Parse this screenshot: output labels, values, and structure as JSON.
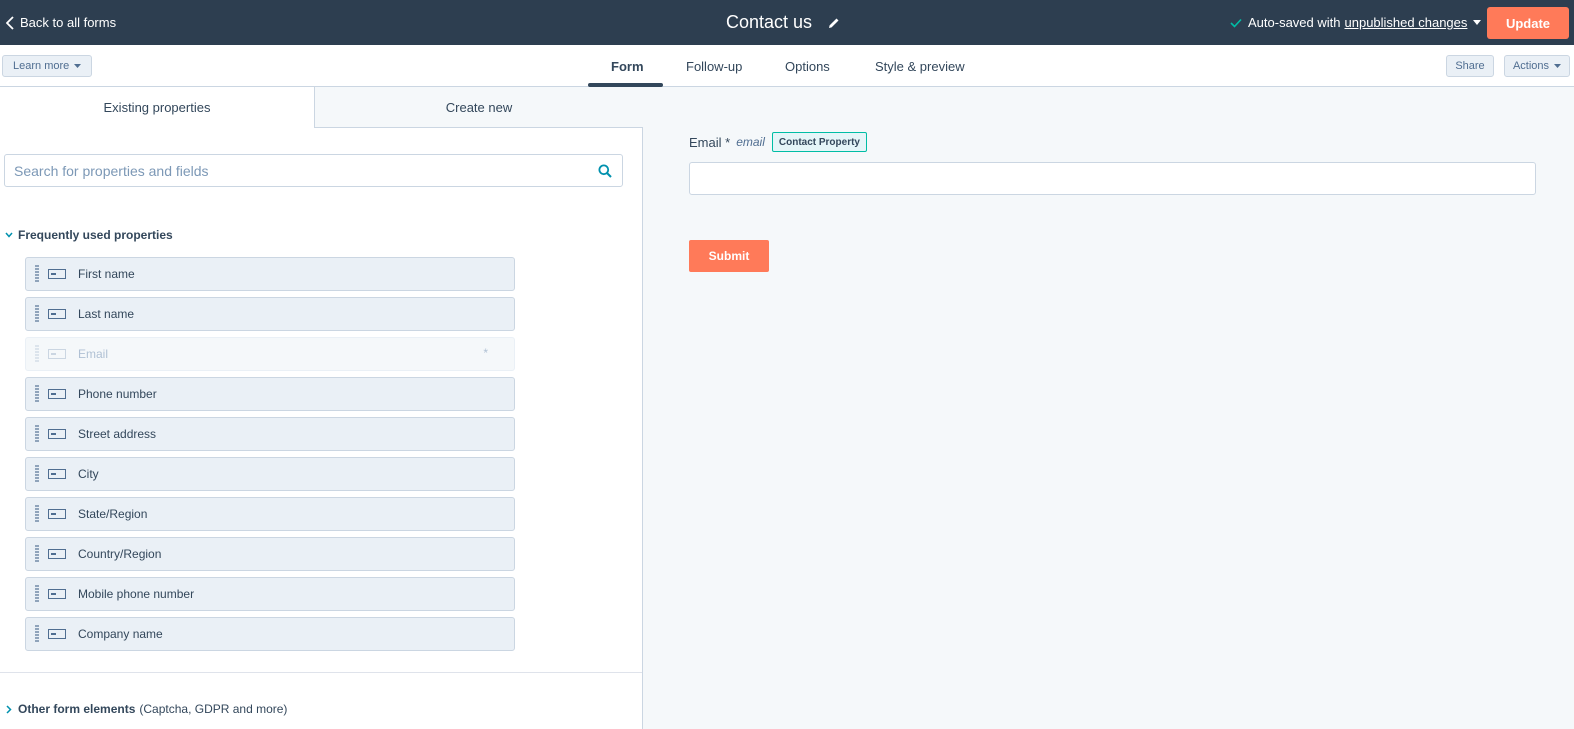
{
  "topbar": {
    "back_label": "Back to all forms",
    "form_title": "Contact us",
    "autosave_text": "Auto-saved with",
    "autosave_link": "unpublished changes",
    "update_label": "Update"
  },
  "subnav": {
    "learn_more_label": "Learn more",
    "tabs": [
      {
        "label": "Form",
        "active": true
      },
      {
        "label": "Follow-up",
        "active": false
      },
      {
        "label": "Options",
        "active": false
      },
      {
        "label": "Style & preview",
        "active": false
      }
    ],
    "share_label": "Share",
    "actions_label": "Actions"
  },
  "left_panel": {
    "tabs": [
      "Existing properties",
      "Create new"
    ],
    "search_placeholder": "Search for properties and fields",
    "section_title": "Frequently used properties",
    "properties": [
      {
        "label": "First name",
        "disabled": false
      },
      {
        "label": "Last name",
        "disabled": false
      },
      {
        "label": "Email",
        "disabled": true,
        "required_mark": "*"
      },
      {
        "label": "Phone number",
        "disabled": false
      },
      {
        "label": "Street address",
        "disabled": false
      },
      {
        "label": "City",
        "disabled": false
      },
      {
        "label": "State/Region",
        "disabled": false
      },
      {
        "label": "Country/Region",
        "disabled": false
      },
      {
        "label": "Mobile phone number",
        "disabled": false
      },
      {
        "label": "Company name",
        "disabled": false
      }
    ],
    "other_title": "Other form elements",
    "other_subtitle": "(Captcha, GDPR and more)"
  },
  "preview": {
    "field_label": "Email *",
    "field_internal_name": "email",
    "field_badge": "Contact Property",
    "submit_label": "Submit"
  },
  "colors": {
    "topbar_bg": "#2d3e50",
    "accent": "#ff7a59",
    "badge_border": "#00bda5",
    "text": "#33475b"
  }
}
